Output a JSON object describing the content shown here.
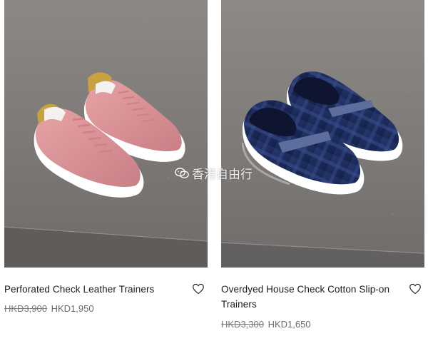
{
  "products": [
    {
      "name": "Perforated Check Leather Trainers",
      "old_price": "HKD3,900",
      "new_price": "HKD1,950",
      "image_subject": "pink-leather-trainers",
      "shoe_color": "#d98f94",
      "wishlist_icon": "heart-outline-icon"
    },
    {
      "name": "Overdyed House Check Cotton Slip-on Trainers",
      "old_price": "HKD3,300",
      "new_price": "HKD1,650",
      "image_subject": "navy-check-slip-on-trainers",
      "shoe_color": "#1c2c5c",
      "wishlist_icon": "heart-outline-icon"
    }
  ],
  "watermark": {
    "text": "香港自由行",
    "icon": "wechat-icon"
  }
}
